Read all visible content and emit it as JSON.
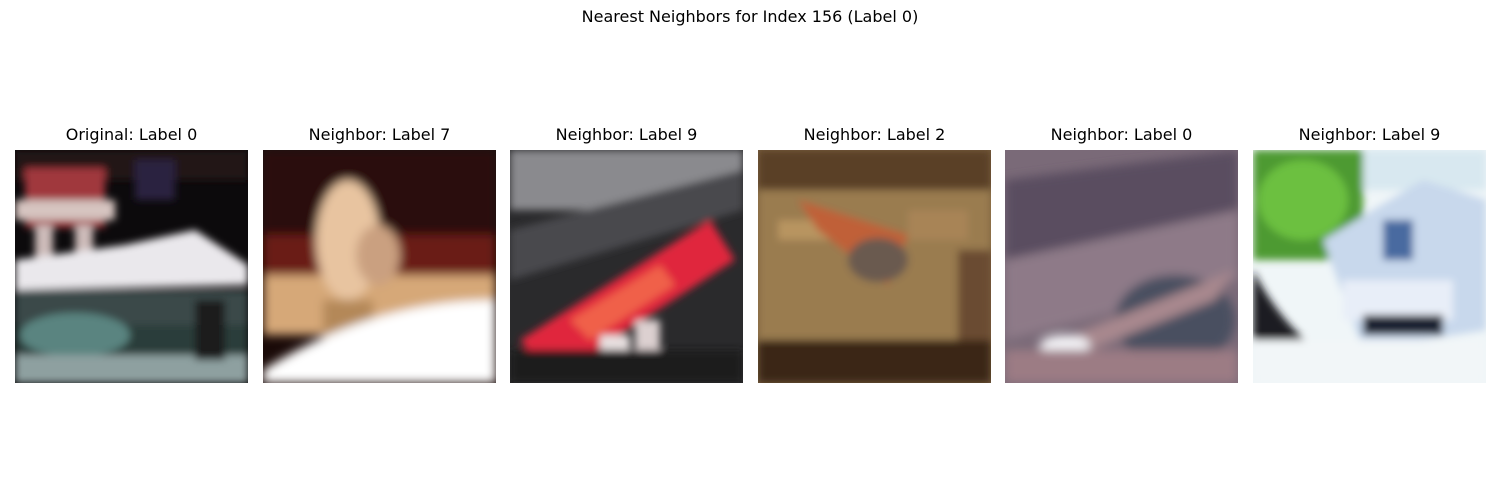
{
  "figure": {
    "title": "Nearest Neighbors for Index 156 (Label 0)",
    "panels": [
      {
        "title": "Original: Label 0"
      },
      {
        "title": "Neighbor: Label 7"
      },
      {
        "title": "Neighbor: Label 9"
      },
      {
        "title": "Neighbor: Label 2"
      },
      {
        "title": "Neighbor: Label 0"
      },
      {
        "title": "Neighbor: Label 9"
      }
    ]
  }
}
